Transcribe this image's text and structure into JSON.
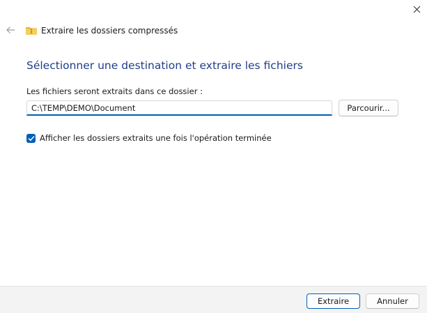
{
  "window": {
    "title": "Extraire les dossiers compressés",
    "close_icon": "close-icon",
    "back_icon": "back-arrow-icon",
    "folder_icon": "zip-folder-icon"
  },
  "main": {
    "heading": "Sélectionner une destination et extraire les fichiers",
    "dest_label": "Les fichiers seront extraits dans ce dossier :",
    "dest_path": "C:\\TEMP\\DEMO\\Document",
    "browse_label": "Parcourir...",
    "show_after_label": "Afficher les dossiers extraits une fois l'opération terminée",
    "show_after_checked": true
  },
  "footer": {
    "extract_label": "Extraire",
    "cancel_label": "Annuler"
  },
  "colors": {
    "accent": "#005fb8",
    "heading": "#1f3f87",
    "footer_bg": "#f3f3f3"
  }
}
